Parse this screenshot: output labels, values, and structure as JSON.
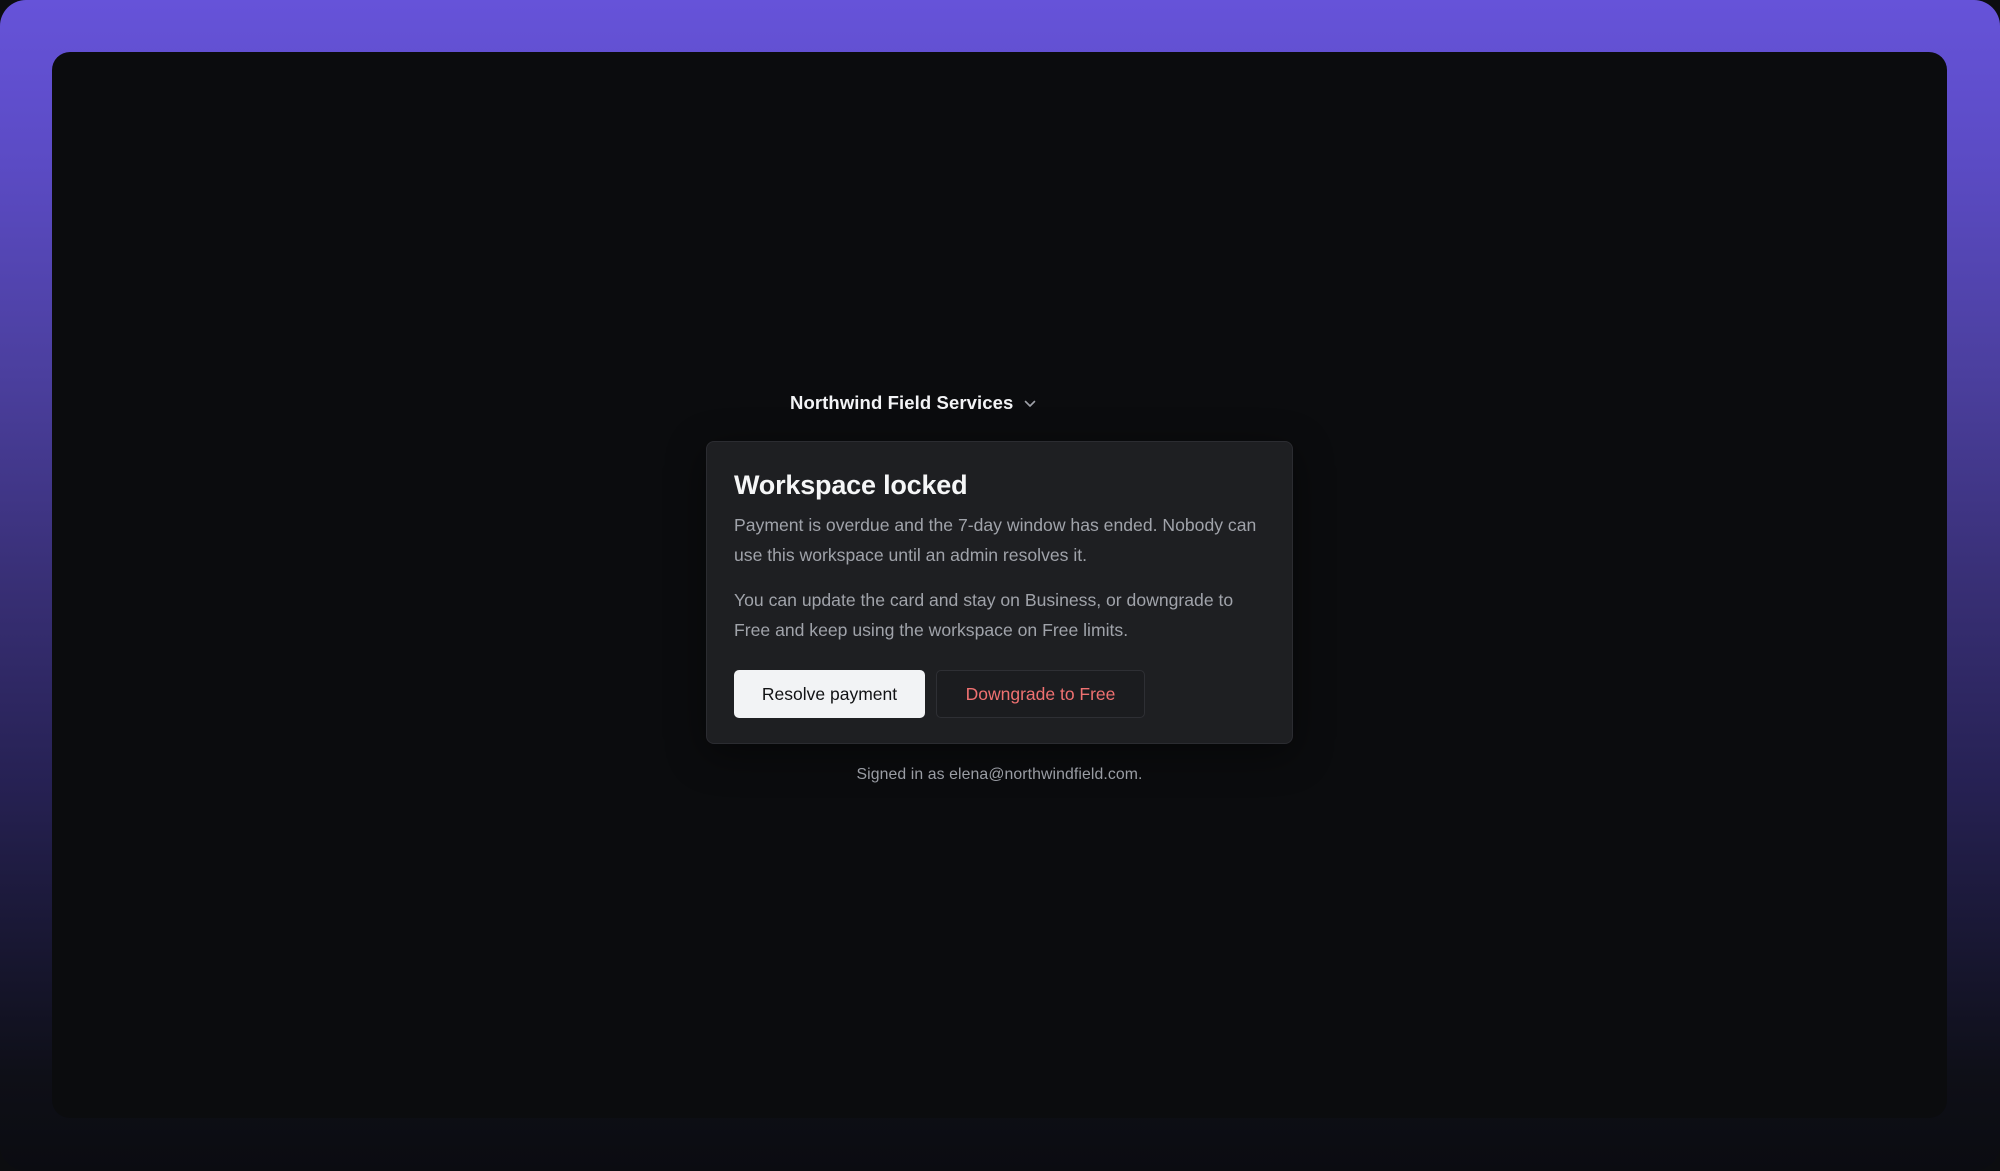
{
  "workspace": {
    "name": "Northwind Field Services",
    "switcher_icon": "chevron-down-icon"
  },
  "lock_card": {
    "title": "Workspace locked",
    "message": "Payment is overdue and the 7-day window has ended. Nobody can use this workspace until an admin resolves it.",
    "options_text": "You can update the card and stay on Business, or downgrade to Free and keep using the workspace on Free limits.",
    "primary_button": "Resolve payment",
    "secondary_button": "Downgrade to Free"
  },
  "footer": {
    "signed_in_text": "Signed in as elena@northwindfield.com."
  },
  "colors": {
    "background_gradient_top": "#6653d9",
    "window_background": "#0b0c0e",
    "card_background": "#1e1f22",
    "danger_text": "#f07171",
    "primary_button_background": "#f2f3f5"
  }
}
